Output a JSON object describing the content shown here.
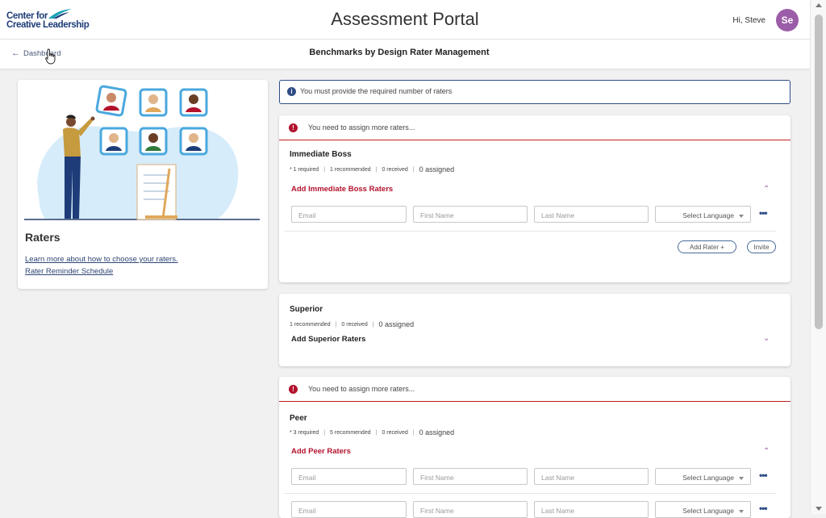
{
  "header": {
    "logo_line1": "Center for",
    "logo_line2": "Creative Leadership",
    "app_title": "Assessment Portal",
    "greeting": "Hi, Steve",
    "avatar_initials": "Se"
  },
  "subheader": {
    "back_label": "Dashboard",
    "page_subtitle": "Benchmarks by Design Rater Management"
  },
  "left_panel": {
    "title": "Raters",
    "links": [
      "Learn more about how to choose your raters.",
      "Rater Reminder Schedule"
    ]
  },
  "notice": {
    "info_text": "You must provide the required number of raters"
  },
  "alerts": {
    "assign_more": "You need to assign more raters..."
  },
  "form": {
    "email_placeholder": "Email",
    "first_name_placeholder": "First Name",
    "last_name_placeholder": "Last Name",
    "select_language": "Select Language",
    "add_rater": "Add Rater",
    "invite": "Invite"
  },
  "sections": {
    "boss": {
      "title": "Immediate Boss",
      "required": "* 1 required",
      "recommended": "1 recommended",
      "received": "0 received",
      "assigned": "0 assigned",
      "add_label": "Add Immediate Boss Raters"
    },
    "superior": {
      "title": "Superior",
      "recommended": "1 recommended",
      "received": "0 received",
      "assigned": "0 assigned",
      "add_label": "Add Superior Raters"
    },
    "peer": {
      "title": "Peer",
      "required": "* 3 required",
      "recommended": "5 recommended",
      "received": "0 received",
      "assigned": "0 assigned",
      "add_label": "Add Peer Raters"
    }
  },
  "colors": {
    "brand_navy": "#2f4d85",
    "alert_red": "#b3122c",
    "avatar_purple": "#9b5ca8"
  }
}
